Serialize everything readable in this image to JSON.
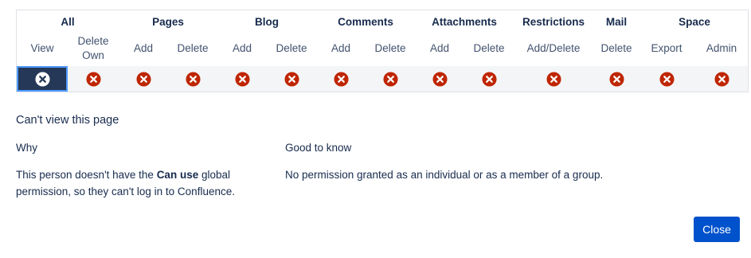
{
  "permissions_table": {
    "groups": [
      {
        "label": "All"
      },
      {
        "label": "Pages"
      },
      {
        "label": "Blog"
      },
      {
        "label": "Comments"
      },
      {
        "label": "Attachments"
      },
      {
        "label": "Restrictions"
      },
      {
        "label": "Mail"
      },
      {
        "label": "Space"
      }
    ],
    "columns": [
      {
        "label": "View",
        "state": "denied",
        "selected": true
      },
      {
        "label": "Delete\nOwn",
        "state": "denied"
      },
      {
        "label": "Add",
        "state": "denied"
      },
      {
        "label": "Delete",
        "state": "denied"
      },
      {
        "label": "Add",
        "state": "denied"
      },
      {
        "label": "Delete",
        "state": "denied"
      },
      {
        "label": "Add",
        "state": "denied"
      },
      {
        "label": "Delete",
        "state": "denied"
      },
      {
        "label": "Add",
        "state": "denied"
      },
      {
        "label": "Delete",
        "state": "denied"
      },
      {
        "label": "Add/Delete",
        "state": "denied"
      },
      {
        "label": "Delete",
        "state": "denied"
      },
      {
        "label": "Export",
        "state": "denied"
      },
      {
        "label": "Admin",
        "state": "denied"
      }
    ],
    "denied_icon": "close-circle-icon"
  },
  "detail": {
    "title": "Can't view this page",
    "why": {
      "heading": "Why",
      "text_before": "This person doesn't have the ",
      "text_bold": "Can use",
      "text_after_line1": " global",
      "text_line2": "permission, so they can't log in to Confluence."
    },
    "good_to_know": {
      "heading": "Good to know",
      "text": "No permission granted as an individual or as a member of a group."
    }
  },
  "footer": {
    "close_label": "Close"
  },
  "colors": {
    "denied": "#bf2600",
    "selected_bg": "#253858",
    "selected_border": "#4c9aff",
    "primary": "#0052cc",
    "row_bg": "#f4f5f7"
  }
}
